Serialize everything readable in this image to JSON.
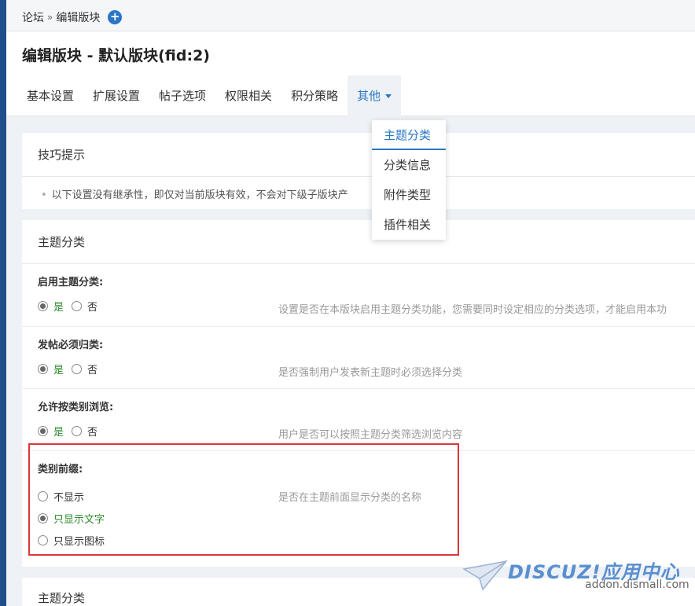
{
  "breadcrumb": {
    "root": "论坛",
    "separator": "»",
    "current": "编辑版块"
  },
  "page": {
    "title": "编辑版块 - 默认版块(fid:2)"
  },
  "tabs": [
    {
      "label": "基本设置"
    },
    {
      "label": "扩展设置"
    },
    {
      "label": "帖子选项"
    },
    {
      "label": "权限相关"
    },
    {
      "label": "积分策略"
    },
    {
      "label": "其他"
    }
  ],
  "dropdown": {
    "items": [
      {
        "label": "主题分类"
      },
      {
        "label": "分类信息"
      },
      {
        "label": "附件类型"
      },
      {
        "label": "插件相关"
      }
    ]
  },
  "tips": {
    "title": "技巧提示",
    "text": "以下设置没有继承性，即仅对当前版块有效，不会对下级子版块产"
  },
  "section": {
    "title": "主题分类",
    "yes_label": "是",
    "no_label": "否",
    "rows": [
      {
        "label": "启用主题分类:",
        "value": "是",
        "desc": "设置是否在本版块启用主题分类功能，您需要同时设定相应的分类选项，才能启用本功"
      },
      {
        "label": "发帖必须归类:",
        "value": "是",
        "desc": "是否强制用户发表新主题时必须选择分类"
      },
      {
        "label": "允许按类别浏览:",
        "value": "是",
        "desc": "用户是否可以按照主题分类筛选浏览内容"
      }
    ],
    "prefix": {
      "label": "类别前缀:",
      "desc": "是否在主题前面显示分类的名称",
      "options": [
        "不显示",
        "只显示文字",
        "只显示图标"
      ],
      "selected": "只显示文字"
    }
  },
  "section2": {
    "title": "主题分类"
  },
  "watermark": {
    "logo": "DISCUZ!应用中心",
    "url": "addon.dismall.com"
  },
  "colors": {
    "accent": "#2a76c6",
    "highlight": "#d9363e",
    "green": "#2e8b2e"
  }
}
